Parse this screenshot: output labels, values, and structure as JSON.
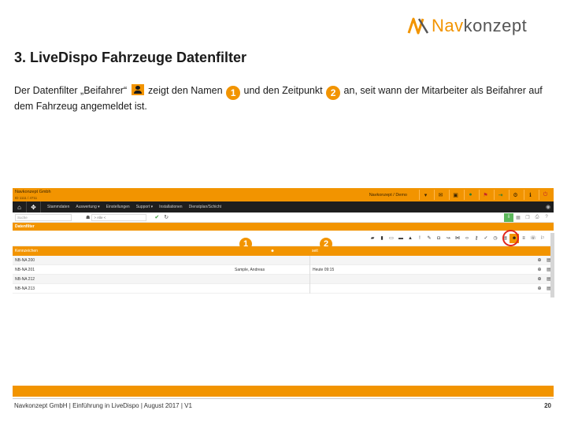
{
  "logo": {
    "part1": "Nav",
    "part2": "konzept"
  },
  "slide": {
    "title": "3. LiveDispo Fahrzeuge Datenfilter",
    "desc": {
      "t1": "Der Datenfilter „Beifahrer“ ",
      "t2": " zeigt den Namen ",
      "b1": "1",
      "t3": " und den Zeitpunkt ",
      "b2": "2",
      "t4": " an, seit wann der Mitarbeiter als Beifahrer auf dem Fahrzeug angemeldet ist."
    }
  },
  "app": {
    "brand": "Navkonzept Gmbh",
    "brand_sub": "ID 1111 / 4711",
    "user": "Navkonzept / Demo",
    "menu": [
      "Stammdaten",
      "Auswertung ▾",
      "Einstellungen",
      "Support ▾",
      "Installationen",
      "Dienstplan/Schicht"
    ],
    "search_placeholder": "Suche",
    "filter_value": "> Alle <",
    "section_title": "Datenfilter",
    "columns": {
      "plate": "Kennzeichen",
      "name": "",
      "since": "seit"
    },
    "rows": [
      {
        "plate": "NB-NA 200",
        "name": "",
        "since": ""
      },
      {
        "plate": "NB-NA 201",
        "name": "Sample, Andreas",
        "since": "Heute 09:15"
      },
      {
        "plate": "NB-NA 212",
        "name": "",
        "since": ""
      },
      {
        "plate": "NB-NA 213",
        "name": "",
        "since": ""
      }
    ],
    "marker1": "1",
    "marker2": "2"
  },
  "footer": {
    "text": "Navkonzept GmbH  |  Einführung in LiveDispo  |  August 2017 | V1",
    "page": "20"
  },
  "colors": {
    "accent": "#f29400",
    "dark": "#1e1e1e",
    "highlight_circle": "#e2261c"
  }
}
